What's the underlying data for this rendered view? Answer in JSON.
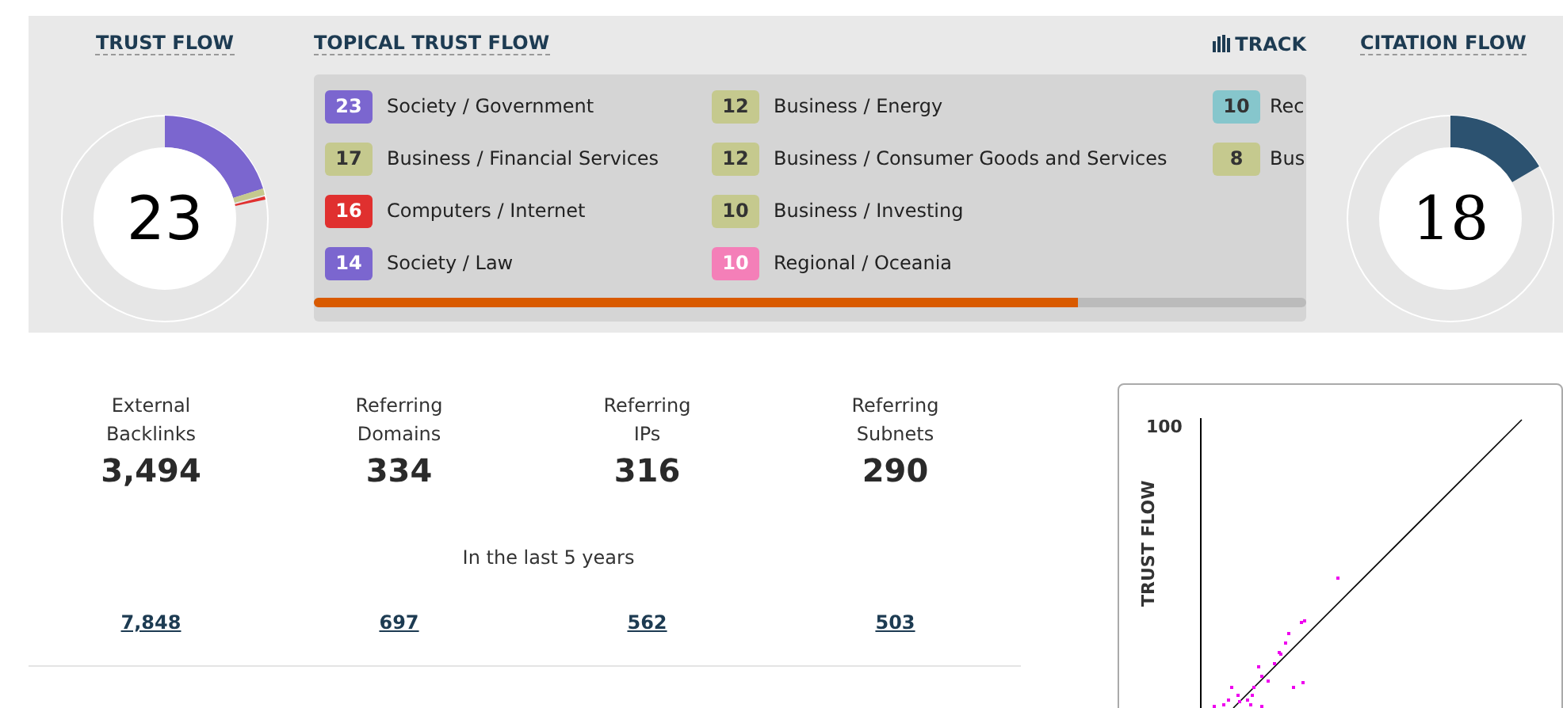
{
  "trust_flow": {
    "title": "TRUST FLOW",
    "score": "23"
  },
  "topical_trust_flow": {
    "title": "TOPICAL TRUST FLOW",
    "track_label": "TRACK",
    "level": 0.77,
    "columns": [
      [
        {
          "value": "23",
          "label": "Society / Government",
          "color": "#7b66cf"
        },
        {
          "value": "17",
          "label": "Business / Financial Services",
          "color": "#c5c98e"
        },
        {
          "value": "16",
          "label": "Computers / Internet",
          "color": "#e0302f"
        },
        {
          "value": "14",
          "label": "Society / Law",
          "color": "#7b66cf"
        }
      ],
      [
        {
          "value": "12",
          "label": "Business / Energy",
          "color": "#c5c98e"
        },
        {
          "value": "12",
          "label": "Business / Consumer Goods and Services",
          "color": "#c5c98e"
        },
        {
          "value": "10",
          "label": "Business / Investing",
          "color": "#c5c98e"
        },
        {
          "value": "10",
          "label": "Regional / Oceania",
          "color": "#f47fb8"
        }
      ],
      [
        {
          "value": "10",
          "label": "Rec",
          "color": "#86c6cc"
        },
        {
          "value": "8",
          "label": "Bus",
          "color": "#c5c98e"
        }
      ]
    ]
  },
  "citation_flow": {
    "title": "CITATION FLOW",
    "score": "18"
  },
  "stats": [
    {
      "label": "External Backlinks",
      "value": "3,494",
      "history": "7,848"
    },
    {
      "label": "Referring Domains",
      "value": "334",
      "history": "697"
    },
    {
      "label": "Referring IPs",
      "value": "316",
      "history": "562"
    },
    {
      "label": "Referring Subnets",
      "value": "290",
      "history": "503"
    }
  ],
  "history_caption": "In the last 5 years",
  "scatter": {
    "y_tick": "100",
    "y_label": "TRUST FLOW"
  }
}
